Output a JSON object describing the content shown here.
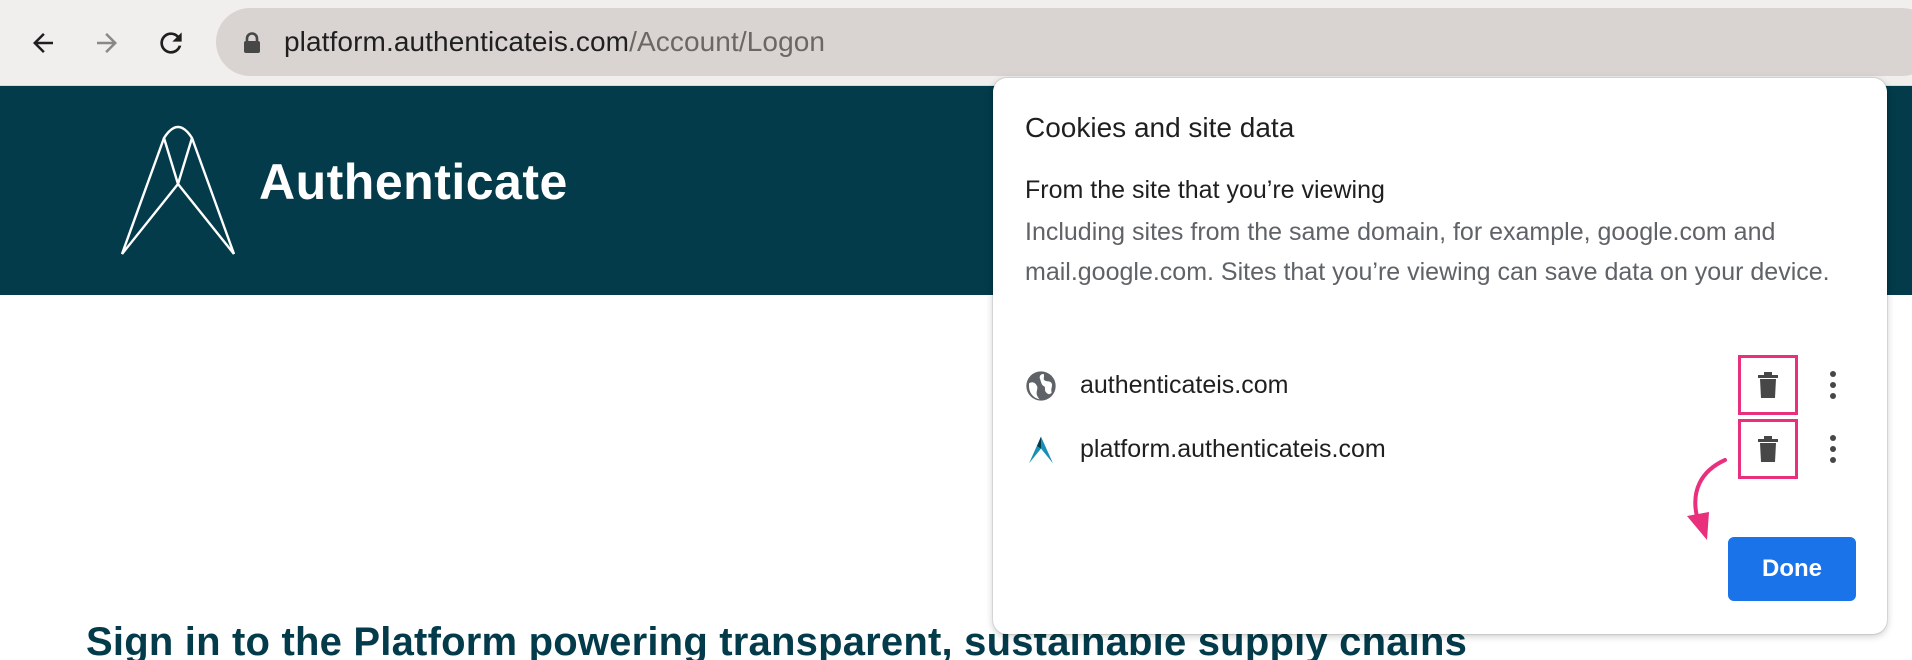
{
  "browser": {
    "url_host": "platform.authenticateis.com",
    "url_path": "/Account/Logon",
    "icons": [
      "back-arrow-icon",
      "forward-arrow-icon",
      "reload-icon",
      "lock-icon"
    ]
  },
  "site": {
    "logo_text": "Authenticate",
    "heading": "Sign in to the Platform powering transparent, sustainable supply chains",
    "brand_color": "#033b4a"
  },
  "cookies_popup": {
    "title": "Cookies and site data",
    "subtitle": "From the site that you’re viewing",
    "description": "Including sites from the same domain, for example, google.com and mail.google.com. Sites that you’re viewing can save data on your device.",
    "sites": [
      {
        "name": "authenticateis.com",
        "icon": "globe-icon"
      },
      {
        "name": "platform.authenticateis.com",
        "icon": "authenticate-favicon-icon"
      }
    ],
    "done_label": "Done",
    "accent_color": "#1a73e8",
    "highlight_color": "#e8307c"
  }
}
